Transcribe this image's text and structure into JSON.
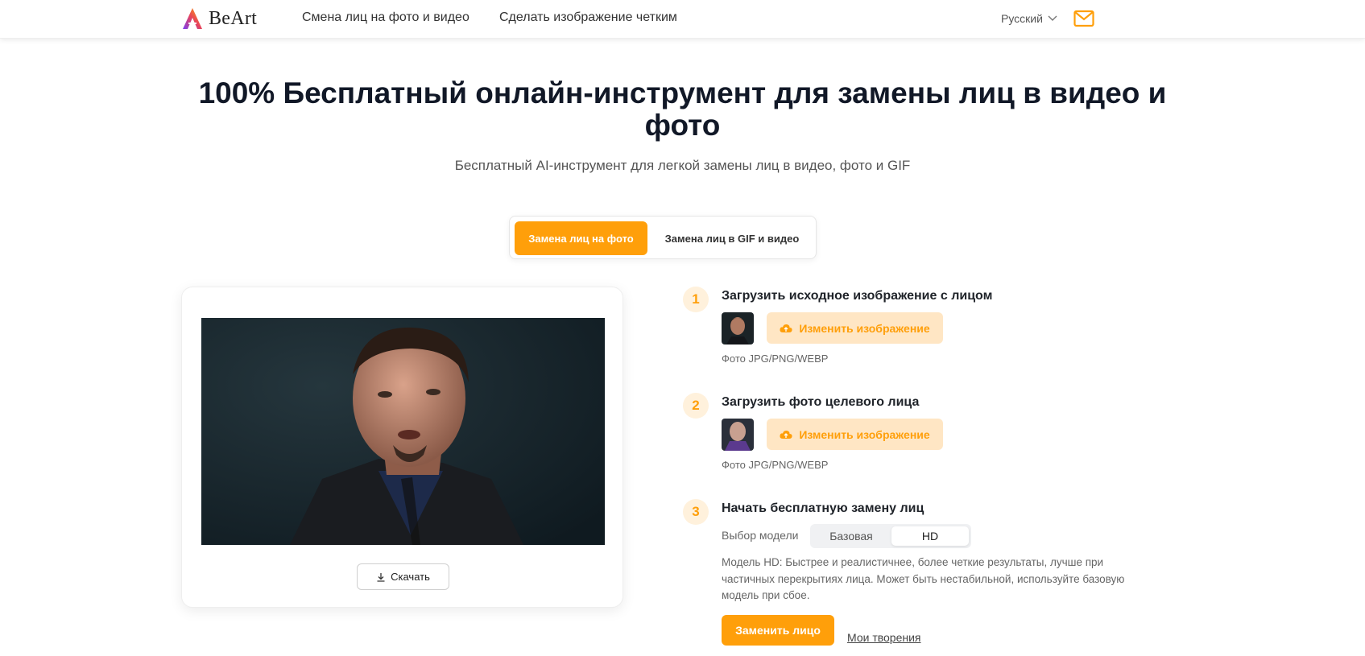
{
  "header": {
    "logo_text": "BeArt",
    "nav": [
      "Смена лиц на фото и видео",
      "Сделать изображение четким"
    ],
    "language": "Русский"
  },
  "hero": {
    "title": "100% Бесплатный онлайн-инструмент для замены лиц в видео и фото",
    "subtitle": "Бесплатный AI-инструмент для легкой замены лиц в видео, фото и GIF"
  },
  "tabs": {
    "active": "Замена лиц на фото",
    "inactive": "Замена лиц в GIF и видео"
  },
  "preview": {
    "download_label": "Скачать"
  },
  "steps": {
    "step1": {
      "number": "1",
      "title": "Загрузить исходное изображение с лицом",
      "button": "Изменить изображение",
      "hint": "Фото JPG/PNG/WEBP"
    },
    "step2": {
      "number": "2",
      "title": "Загрузить фото целевого лица",
      "button": "Изменить изображение",
      "hint": "Фото JPG/PNG/WEBP"
    },
    "step3": {
      "number": "3",
      "title": "Начать бесплатную замену лиц",
      "model_label": "Выбор модели",
      "model_options": [
        "Базовая",
        "HD"
      ],
      "model_selected": "HD",
      "model_description": "Модель HD: Быстрее и реалистичнее, более четкие результаты, лучше при частичных перекрытиях лица. Может быть нестабильной, используйте базовую модель при сбое.",
      "swap_button": "Заменить лицо",
      "my_works_link": "Мои творения"
    }
  },
  "colors": {
    "accent": "#ff9f0a",
    "accent_light": "#ffe6c4",
    "step_circle": "#fff1dc"
  }
}
